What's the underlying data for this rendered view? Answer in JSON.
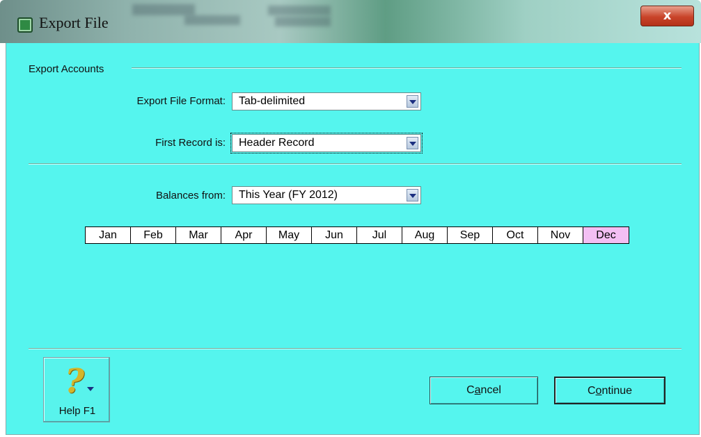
{
  "window": {
    "title": "Export File",
    "close_label": "x"
  },
  "section": {
    "title": "Export Accounts"
  },
  "fields": {
    "format_label": "Export File Format:",
    "format_value": "Tab-delimited",
    "first_record_label": "First Record is:",
    "first_record_value": "Header Record",
    "balances_label": "Balances from:",
    "balances_value": "This Year (FY 2012)"
  },
  "months": {
    "items": [
      "Jan",
      "Feb",
      "Mar",
      "Apr",
      "May",
      "Jun",
      "Jul",
      "Aug",
      "Sep",
      "Oct",
      "Nov",
      "Dec"
    ],
    "selected": "Dec"
  },
  "buttons": {
    "help_label": "Help F1",
    "help_glyph": "?",
    "cancel_pre": "C",
    "cancel_ul": "a",
    "cancel_post": "ncel",
    "continue_pre": "C",
    "continue_ul": "o",
    "continue_post": "ntinue"
  },
  "colors": {
    "dialog_bg": "#55f5ee",
    "selected_month": "#f3bff3",
    "close_button": "#c9442a"
  },
  "icons": {
    "app": "green-app-icon",
    "close": "close-icon",
    "dropdown": "chevron-down-icon",
    "help": "question-mark-icon"
  }
}
